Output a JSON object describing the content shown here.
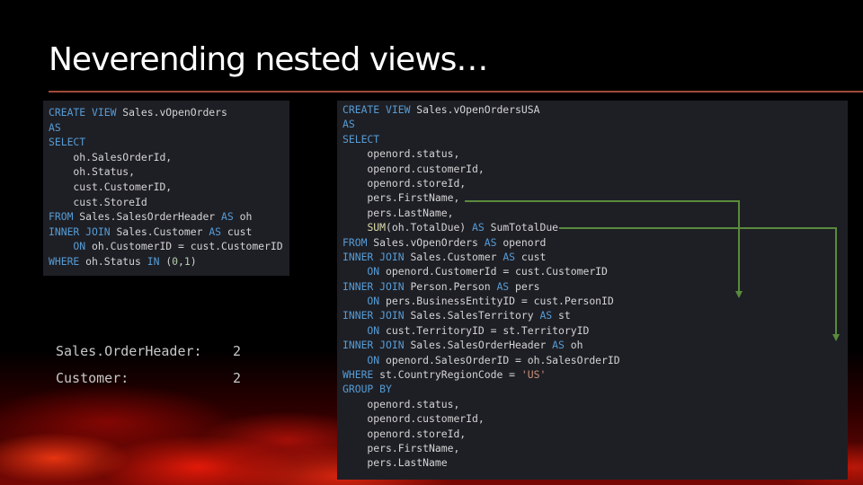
{
  "slide": {
    "title": "Neverending nested views…"
  },
  "left_code": {
    "lines": [
      [
        {
          "t": "CREATE VIEW ",
          "c": "kw"
        },
        {
          "t": "Sales.vOpenOrders",
          "c": ""
        }
      ],
      [
        {
          "t": "AS",
          "c": "kw"
        }
      ],
      [
        {
          "t": "SELECT",
          "c": "kw"
        }
      ],
      [
        {
          "t": "    oh.SalesOrderId,",
          "c": ""
        }
      ],
      [
        {
          "t": "    oh.Status,",
          "c": ""
        }
      ],
      [
        {
          "t": "    cust.CustomerID,",
          "c": ""
        }
      ],
      [
        {
          "t": "    cust.StoreId",
          "c": ""
        }
      ],
      [
        {
          "t": "FROM ",
          "c": "kw"
        },
        {
          "t": "Sales.SalesOrderHeader ",
          "c": ""
        },
        {
          "t": "AS ",
          "c": "kw"
        },
        {
          "t": "oh",
          "c": ""
        }
      ],
      [
        {
          "t": "INNER JOIN ",
          "c": "kw"
        },
        {
          "t": "Sales.Customer ",
          "c": ""
        },
        {
          "t": "AS ",
          "c": "kw"
        },
        {
          "t": "cust",
          "c": ""
        }
      ],
      [
        {
          "t": "    ON ",
          "c": "kw"
        },
        {
          "t": "oh.CustomerID = cust.CustomerID",
          "c": ""
        }
      ],
      [
        {
          "t": "WHERE ",
          "c": "kw"
        },
        {
          "t": "oh.Status ",
          "c": ""
        },
        {
          "t": "IN ",
          "c": "kw"
        },
        {
          "t": "(",
          "c": ""
        },
        {
          "t": "0",
          "c": "num"
        },
        {
          "t": ",",
          "c": ""
        },
        {
          "t": "1",
          "c": "num"
        },
        {
          "t": ")",
          "c": ""
        }
      ]
    ]
  },
  "right_code": {
    "lines": [
      [
        {
          "t": "CREATE VIEW ",
          "c": "kw"
        },
        {
          "t": "Sales.vOpenOrdersUSA",
          "c": ""
        }
      ],
      [
        {
          "t": "AS",
          "c": "kw"
        }
      ],
      [
        {
          "t": "SELECT",
          "c": "kw"
        }
      ],
      [
        {
          "t": "    openord.status,",
          "c": ""
        }
      ],
      [
        {
          "t": "    openord.customerId,",
          "c": ""
        }
      ],
      [
        {
          "t": "    openord.storeId,",
          "c": ""
        }
      ],
      [
        {
          "t": "    pers.FirstName,",
          "c": ""
        }
      ],
      [
        {
          "t": "    pers.LastName,",
          "c": ""
        }
      ],
      [
        {
          "t": "    ",
          "c": ""
        },
        {
          "t": "SUM",
          "c": "fn"
        },
        {
          "t": "(oh.TotalDue) ",
          "c": ""
        },
        {
          "t": "AS ",
          "c": "kw"
        },
        {
          "t": "SumTotalDue",
          "c": ""
        }
      ],
      [
        {
          "t": "FROM ",
          "c": "kw"
        },
        {
          "t": "Sales.vOpenOrders ",
          "c": ""
        },
        {
          "t": "AS ",
          "c": "kw"
        },
        {
          "t": "openord",
          "c": ""
        }
      ],
      [
        {
          "t": "INNER JOIN ",
          "c": "kw"
        },
        {
          "t": "Sales.Customer ",
          "c": ""
        },
        {
          "t": "AS ",
          "c": "kw"
        },
        {
          "t": "cust",
          "c": ""
        }
      ],
      [
        {
          "t": "    ON ",
          "c": "kw"
        },
        {
          "t": "openord.CustomerId = cust.CustomerID",
          "c": ""
        }
      ],
      [
        {
          "t": "INNER JOIN ",
          "c": "kw"
        },
        {
          "t": "Person.Person ",
          "c": ""
        },
        {
          "t": "AS ",
          "c": "kw"
        },
        {
          "t": "pers",
          "c": ""
        }
      ],
      [
        {
          "t": "    ON ",
          "c": "kw"
        },
        {
          "t": "pers.BusinessEntityID = cust.PersonID",
          "c": ""
        }
      ],
      [
        {
          "t": "INNER JOIN ",
          "c": "kw"
        },
        {
          "t": "Sales.SalesTerritory ",
          "c": ""
        },
        {
          "t": "AS ",
          "c": "kw"
        },
        {
          "t": "st",
          "c": ""
        }
      ],
      [
        {
          "t": "    ON ",
          "c": "kw"
        },
        {
          "t": "cust.TerritoryID = st.TerritoryID",
          "c": ""
        }
      ],
      [
        {
          "t": "INNER JOIN ",
          "c": "kw"
        },
        {
          "t": "Sales.SalesOrderHeader ",
          "c": ""
        },
        {
          "t": "AS ",
          "c": "kw"
        },
        {
          "t": "oh",
          "c": ""
        }
      ],
      [
        {
          "t": "    ON ",
          "c": "kw"
        },
        {
          "t": "openord.SalesOrderID = oh.SalesOrderID",
          "c": ""
        }
      ],
      [
        {
          "t": "WHERE ",
          "c": "kw"
        },
        {
          "t": "st.CountryRegionCode = ",
          "c": ""
        },
        {
          "t": "'US'",
          "c": "str"
        }
      ],
      [
        {
          "t": "GROUP BY",
          "c": "kw"
        }
      ],
      [
        {
          "t": "    openord.status,",
          "c": ""
        }
      ],
      [
        {
          "t": "    openord.customerId,",
          "c": ""
        }
      ],
      [
        {
          "t": "    openord.storeId,",
          "c": ""
        }
      ],
      [
        {
          "t": "    pers.FirstName,",
          "c": ""
        }
      ],
      [
        {
          "t": "    pers.LastName",
          "c": ""
        }
      ]
    ]
  },
  "counts": [
    {
      "label": "Sales.OrderHeader:",
      "value": "2"
    },
    {
      "label": "Customer:",
      "value": "2"
    }
  ],
  "colors": {
    "arrow": "#5a8a3c",
    "keyword": "#569cd6",
    "title_rule": "#a04a3a"
  }
}
